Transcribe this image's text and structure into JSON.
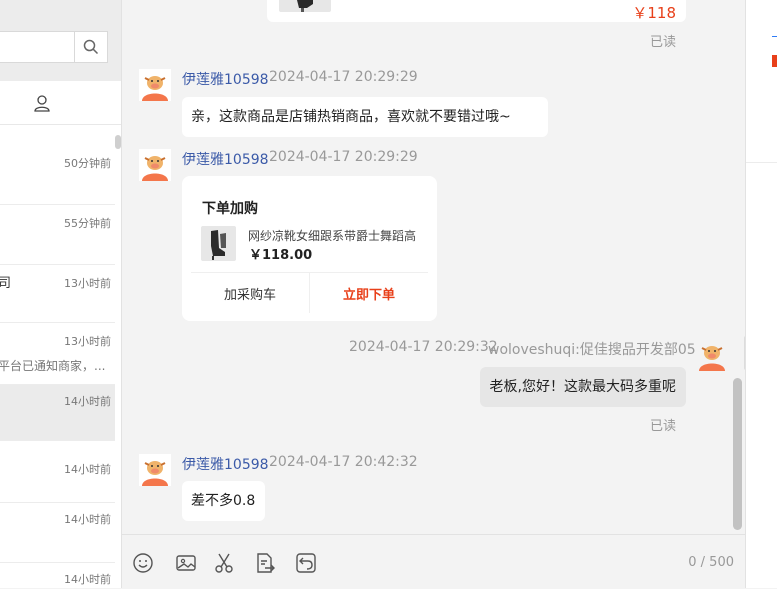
{
  "search": {
    "placeholder": "",
    "value": ""
  },
  "icons": {
    "search": "search-icon",
    "contacts": "user-icon",
    "avatar": "cow-avatar-icon",
    "expand": "double-chevron-right-icon"
  },
  "conversations": [
    {
      "time": "50分钟前",
      "name": "",
      "preview": ""
    },
    {
      "time": "55分钟前",
      "name": "",
      "preview": ""
    },
    {
      "time": "13小时前",
      "name": "司",
      "preview": ""
    },
    {
      "time": "13小时前",
      "name": "",
      "preview": "平台已通知商家，..."
    },
    {
      "time": "14小时前",
      "name": "",
      "preview": "",
      "selected": true
    },
    {
      "time": "14小时前",
      "name": "",
      "preview": ""
    },
    {
      "time": "14小时前",
      "name": "",
      "preview": ""
    },
    {
      "time": "14小时前",
      "name": "",
      "preview": ""
    }
  ],
  "chat": {
    "top_price": "￥118",
    "top_read": "已读",
    "messages": {
      "m1": {
        "sender": "伊莲雅10598",
        "time": "2024-04-17 20:29:29",
        "text": "亲，这款商品是店铺热销商品，喜欢就不要错过哦~"
      },
      "m2": {
        "sender": "伊莲雅10598",
        "time": "2024-04-17 20:29:29"
      },
      "m3": {
        "sender": "woloveshuqi:促佳搜品开发部057",
        "time": "2024-04-17 20:29:32",
        "text": "老板,您好！这款最大码多重呢",
        "read": "已读"
      },
      "m4": {
        "sender": "伊莲雅10598",
        "time": "2024-04-17 20:42:32",
        "text": "差不多0.8"
      }
    },
    "card": {
      "title": "下单加购",
      "product_name": "网纱凉靴女细跟系带爵士舞蹈高",
      "price": "￥118.00",
      "add_cart_label": "加采购车",
      "buy_label": "立即下单"
    }
  },
  "toolbar": {
    "icons": [
      "emoji-icon",
      "image-icon",
      "scissors-icon",
      "document-send-icon",
      "recall-icon"
    ],
    "counter": "0 / 500"
  },
  "colors": {
    "accent": "#e8401a",
    "name_blue": "#3b5aa8",
    "price_red": "#e8401a"
  }
}
